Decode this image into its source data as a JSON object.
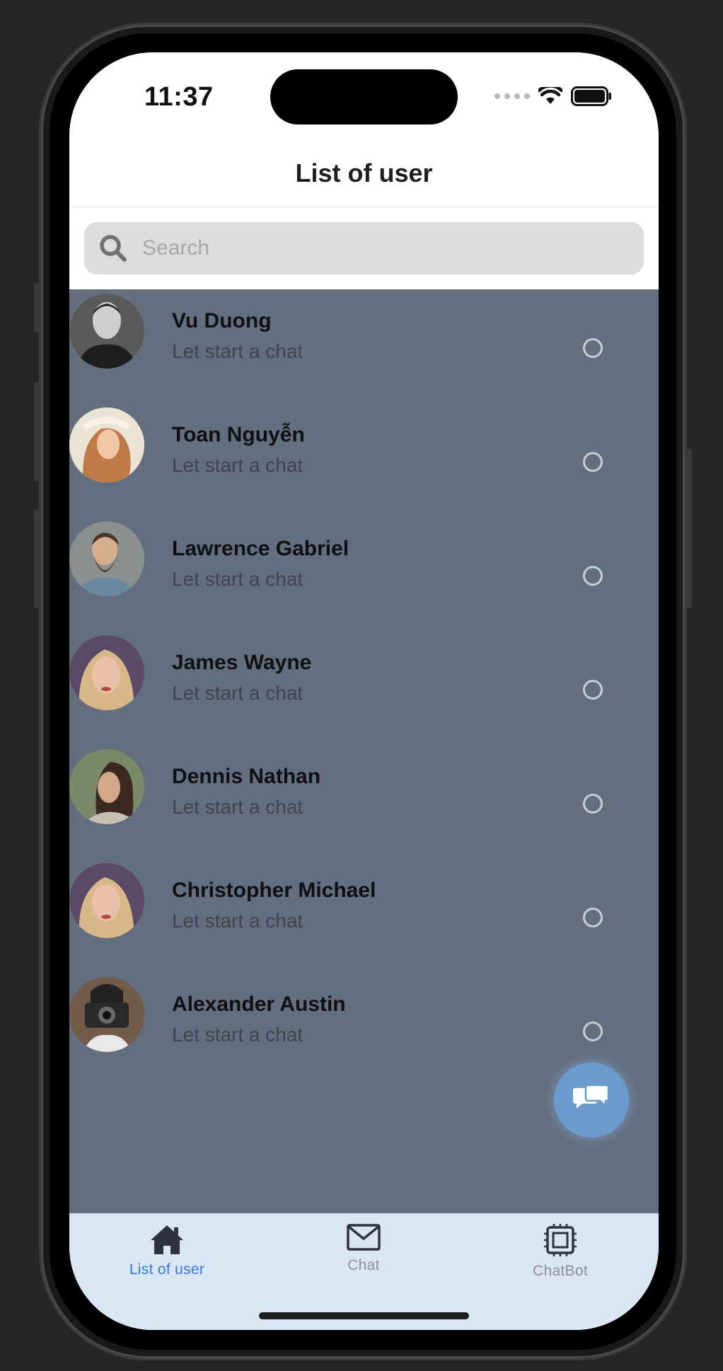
{
  "status": {
    "time": "11:37"
  },
  "header": {
    "title": "List of user"
  },
  "search": {
    "placeholder": "Search"
  },
  "users": [
    {
      "name": "Vu Duong",
      "subtitle": "Let start a chat",
      "avatar_color": "#5a5a5a"
    },
    {
      "name": "Toan Nguyễn",
      "subtitle": "Let start a chat",
      "avatar_color": "#c9a37a"
    },
    {
      "name": "Lawrence Gabriel",
      "subtitle": "Let start a chat",
      "avatar_color": "#6a5a48"
    },
    {
      "name": "James Wayne",
      "subtitle": "Let start a chat",
      "avatar_color": "#8a6a70"
    },
    {
      "name": "Dennis Nathan",
      "subtitle": "Let start a chat",
      "avatar_color": "#6a5a4a"
    },
    {
      "name": "Christopher Michael",
      "subtitle": "Let start a chat",
      "avatar_color": "#8a6a70"
    },
    {
      "name": "Alexander Austin",
      "subtitle": "Let start a chat",
      "avatar_color": "#4a4a4a"
    }
  ],
  "tabs": [
    {
      "label": "List of user",
      "icon": "home-icon",
      "active": true
    },
    {
      "label": "Chat",
      "icon": "mail-icon",
      "active": false
    },
    {
      "label": "ChatBot",
      "icon": "chip-icon",
      "active": false
    }
  ],
  "colors": {
    "list_background": "#636e7e",
    "fab": "#6b9bcd",
    "tabbar": "#dbe6f4",
    "active_tab": "#3478d8"
  }
}
